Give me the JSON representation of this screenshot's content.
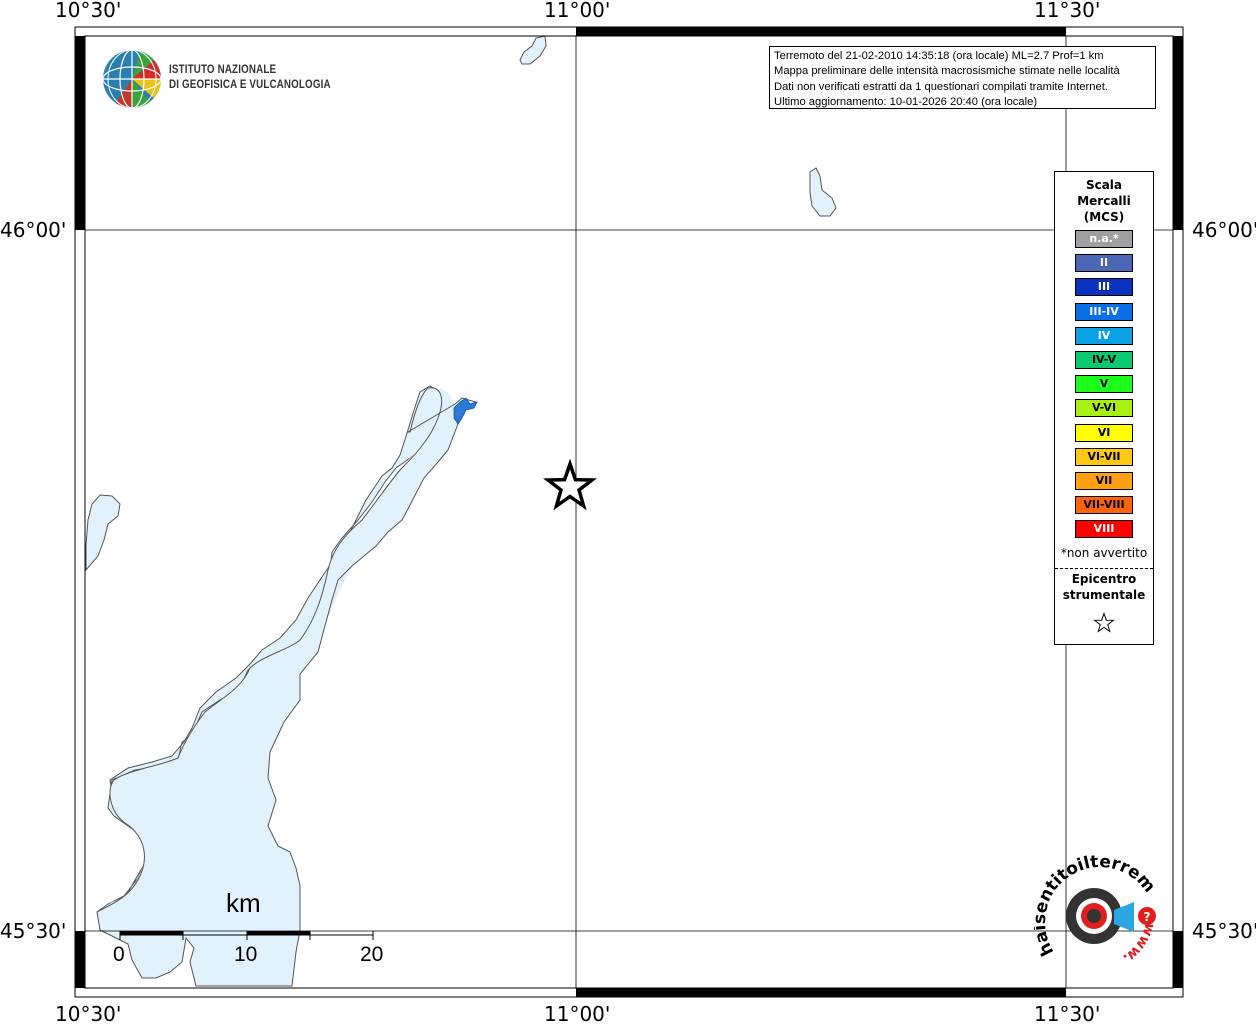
{
  "axes": {
    "top": [
      "10°30'",
      "11°00'",
      "11°30'"
    ],
    "bottom": [
      "10°30'",
      "11°00'",
      "11°30'"
    ],
    "left": [
      "46°00'",
      "45°30'"
    ],
    "right": [
      "46°00'",
      "45°30'"
    ]
  },
  "info": {
    "line1": "Terremoto del 21-02-2010 14:35:18 (ora locale) ML=2.7 Prof=1 km",
    "line2": "Mappa preliminare delle intensità macrosismiche stimate nelle località",
    "line3": "Dati non verificati estratti da 1 questionari compilati tramite Internet.",
    "line4": "Ultimo aggiornamento: 10-01-2026 20:40 (ora locale)"
  },
  "institute": {
    "line1": "ISTITUTO NAZIONALE",
    "line2": "DI GEOFISICA E VULCANOLOGIA"
  },
  "legend": {
    "title1": "Scala",
    "title2": "Mercalli",
    "title3": "(MCS)",
    "classes": [
      {
        "label": "n.a.*",
        "color": "#a0a0a0"
      },
      {
        "label": "II",
        "color": "#4a66b4"
      },
      {
        "label": "III",
        "color": "#0a32be"
      },
      {
        "label": "III-IV",
        "color": "#0a6ee6"
      },
      {
        "label": "IV",
        "color": "#0aa0e6"
      },
      {
        "label": "IV-V",
        "color": "#0ac86e"
      },
      {
        "label": "V",
        "color": "#1eff1e"
      },
      {
        "label": "V-VI",
        "color": "#a8f014"
      },
      {
        "label": "VI",
        "color": "#ffff00"
      },
      {
        "label": "VI-VII",
        "color": "#ffc814"
      },
      {
        "label": "VII",
        "color": "#ffa014"
      },
      {
        "label": "VII-VIII",
        "color": "#ff640a"
      },
      {
        "label": "VIII",
        "color": "#ff0000"
      }
    ],
    "note": "*non avvertito",
    "epicenter1": "Epicentro",
    "epicenter2": "strumentale"
  },
  "scalebar": {
    "unit": "km",
    "labels": [
      "0",
      "10",
      "20"
    ]
  },
  "brand": {
    "text": "haisentitoilterremoto.it",
    "www": "www."
  },
  "colors": {
    "lake_fill": "#e1f2fd",
    "coast": "#555555",
    "lake_blue": "#2a7ad8"
  }
}
